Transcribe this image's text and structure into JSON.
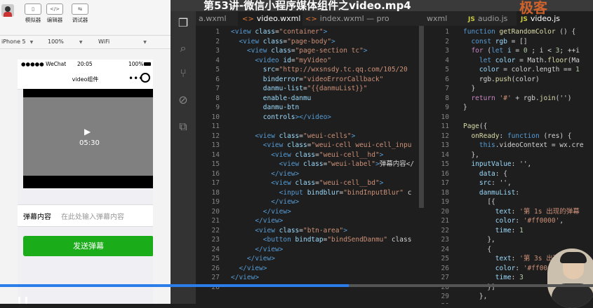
{
  "video_title": "第53讲-微信小程序媒体组件之video.mp4",
  "watermark": "极客",
  "simulator": {
    "toolbar": {
      "tools": [
        {
          "label": "模拟器",
          "icon": "phone-icon"
        },
        {
          "label": "编辑器",
          "icon": "code-icon"
        },
        {
          "label": "调试器",
          "icon": "debug-icon"
        }
      ]
    },
    "device": "iPhone 5",
    "zoom": "100%",
    "network": "WiFi",
    "status": {
      "carrier": "●●●●● WeChat",
      "time": "20:05",
      "battery": "100%"
    },
    "nav_title": "video组件",
    "video": {
      "duration": "05:30"
    },
    "danmu_label": "弹幕内容",
    "danmu_placeholder": "在此处输入弹幕内容",
    "send_button": "发送弹幕"
  },
  "tabs": {
    "left": [
      {
        "label": "a.wxml",
        "type": "wxml",
        "active": false
      },
      {
        "label": "video.wxml",
        "type": "wxml",
        "active": true
      },
      {
        "label": "index.wxml — pro",
        "type": "wxml",
        "active": false
      }
    ],
    "right": [
      {
        "label": "wxml",
        "type": "wxml",
        "active": false
      },
      {
        "label": "audio.js",
        "type": "js",
        "active": false
      },
      {
        "label": "video.js",
        "type": "js",
        "active": true
      }
    ]
  },
  "editor_left": {
    "line_numbers": [
      "1",
      "2",
      "3",
      "4",
      "5",
      "6",
      "7",
      "8",
      "9",
      "10",
      "11",
      "12",
      "13",
      "14",
      "15",
      "16",
      "17",
      "18",
      "19",
      "20",
      "21",
      "22",
      "23",
      "24",
      "25",
      "26",
      "27",
      "28"
    ],
    "lines": [
      [
        [
          "tg",
          "<view "
        ],
        [
          "at",
          "class"
        ],
        [
          "pl",
          "="
        ],
        [
          "sv",
          "\"container\""
        ],
        [
          "tg",
          ">"
        ]
      ],
      [
        [
          "pl",
          "  "
        ],
        [
          "tg",
          "<view "
        ],
        [
          "at",
          "class"
        ],
        [
          "pl",
          "="
        ],
        [
          "sv",
          "\"page-body\""
        ],
        [
          "tg",
          ">"
        ]
      ],
      [
        [
          "pl",
          "    "
        ],
        [
          "tg",
          "<view "
        ],
        [
          "at",
          "class"
        ],
        [
          "pl",
          "="
        ],
        [
          "sv",
          "\"page-section tc\""
        ],
        [
          "tg",
          ">"
        ]
      ],
      [
        [
          "pl",
          "      "
        ],
        [
          "tg",
          "<video "
        ],
        [
          "at",
          "id"
        ],
        [
          "pl",
          "="
        ],
        [
          "sv",
          "\"myVideo\""
        ]
      ],
      [
        [
          "pl",
          "        "
        ],
        [
          "at",
          "src"
        ],
        [
          "pl",
          "="
        ],
        [
          "sv",
          "\"http://wxsnsdy.tc.qq.com/105/20"
        ]
      ],
      [
        [
          "pl",
          "        "
        ],
        [
          "at",
          "binderror"
        ],
        [
          "pl",
          "="
        ],
        [
          "sv",
          "\"videoErrorCallback\""
        ]
      ],
      [
        [
          "pl",
          "        "
        ],
        [
          "at",
          "danmu-list"
        ],
        [
          "pl",
          "="
        ],
        [
          "sv",
          "\"{{danmuList}}\""
        ]
      ],
      [
        [
          "pl",
          "        "
        ],
        [
          "at",
          "enable-danmu"
        ]
      ],
      [
        [
          "pl",
          "        "
        ],
        [
          "at",
          "danmu-btn"
        ]
      ],
      [
        [
          "pl",
          "        "
        ],
        [
          "at",
          "controls"
        ],
        [
          "tg",
          "></video>"
        ]
      ],
      [
        [
          "pl",
          ""
        ]
      ],
      [
        [
          "pl",
          "      "
        ],
        [
          "tg",
          "<view "
        ],
        [
          "at",
          "class"
        ],
        [
          "pl",
          "="
        ],
        [
          "sv",
          "\"weui-cells\""
        ],
        [
          "tg",
          ">"
        ]
      ],
      [
        [
          "pl",
          "        "
        ],
        [
          "tg",
          "<view "
        ],
        [
          "at",
          "class"
        ],
        [
          "pl",
          "="
        ],
        [
          "sv",
          "\"weui-cell weui-cell_inpu"
        ]
      ],
      [
        [
          "pl",
          "          "
        ],
        [
          "tg",
          "<view "
        ],
        [
          "at",
          "class"
        ],
        [
          "pl",
          "="
        ],
        [
          "sv",
          "\"weui-cell__hd\""
        ],
        [
          "tg",
          ">"
        ]
      ],
      [
        [
          "pl",
          "            "
        ],
        [
          "tg",
          "<view "
        ],
        [
          "at",
          "class"
        ],
        [
          "pl",
          "="
        ],
        [
          "sv",
          "\"weui-label\""
        ],
        [
          "tg",
          ">"
        ],
        [
          "pl",
          "弹幕内容</"
        ]
      ],
      [
        [
          "pl",
          "          "
        ],
        [
          "tg",
          "</view>"
        ]
      ],
      [
        [
          "pl",
          "          "
        ],
        [
          "tg",
          "<view "
        ],
        [
          "at",
          "class"
        ],
        [
          "pl",
          "="
        ],
        [
          "sv",
          "\"weui-cell__bd\""
        ],
        [
          "tg",
          ">"
        ]
      ],
      [
        [
          "pl",
          "            "
        ],
        [
          "tg",
          "<input "
        ],
        [
          "at",
          "bindblur"
        ],
        [
          "pl",
          "="
        ],
        [
          "sv",
          "\"bindInputBlur\""
        ],
        [
          "pl",
          " c"
        ]
      ],
      [
        [
          "pl",
          "          "
        ],
        [
          "tg",
          "</view>"
        ]
      ],
      [
        [
          "pl",
          "        "
        ],
        [
          "tg",
          "</view>"
        ]
      ],
      [
        [
          "pl",
          "      "
        ],
        [
          "tg",
          "</view>"
        ]
      ],
      [
        [
          "pl",
          "      "
        ],
        [
          "tg",
          "<view "
        ],
        [
          "at",
          "class"
        ],
        [
          "pl",
          "="
        ],
        [
          "sv",
          "\"btn-area\""
        ],
        [
          "tg",
          ">"
        ]
      ],
      [
        [
          "pl",
          "        "
        ],
        [
          "tg",
          "<button "
        ],
        [
          "at",
          "bindtap"
        ],
        [
          "pl",
          "="
        ],
        [
          "sv",
          "\"bindSendDanmu\""
        ],
        [
          "pl",
          " class"
        ]
      ],
      [
        [
          "pl",
          "      "
        ],
        [
          "tg",
          "</view>"
        ]
      ],
      [
        [
          "pl",
          "    "
        ],
        [
          "tg",
          "</view>"
        ]
      ],
      [
        [
          "pl",
          "  "
        ],
        [
          "tg",
          "</view>"
        ]
      ],
      [
        [
          "tg",
          "</view>"
        ]
      ],
      [
        [
          "pl",
          ""
        ]
      ]
    ]
  },
  "editor_right": {
    "line_numbers": [
      "1",
      "2",
      "3",
      "4",
      "5",
      "6",
      "7",
      "8",
      "9",
      "10",
      "11",
      "12",
      "13",
      "14",
      "15",
      "16",
      "17",
      "18",
      "19",
      "20",
      "21",
      "22",
      "23",
      "24",
      "25",
      "26",
      "27",
      "28",
      "29",
      "30"
    ],
    "lines": [
      [
        [
          "kw2",
          "function "
        ],
        [
          "fn",
          "getRandomColor"
        ],
        [
          "pl",
          " () {"
        ]
      ],
      [
        [
          "pl",
          "  "
        ],
        [
          "kw2",
          "const "
        ],
        [
          "at",
          "rgb"
        ],
        [
          "pl",
          " = []"
        ]
      ],
      [
        [
          "pl",
          "  "
        ],
        [
          "kw",
          "for"
        ],
        [
          "pl",
          " ("
        ],
        [
          "kw2",
          "let "
        ],
        [
          "at",
          "i"
        ],
        [
          "pl",
          " = "
        ],
        [
          "nm",
          "0"
        ],
        [
          "pl",
          " ; i < "
        ],
        [
          "nm",
          "3"
        ],
        [
          "pl",
          "; ++i"
        ]
      ],
      [
        [
          "pl",
          "    "
        ],
        [
          "kw2",
          "let "
        ],
        [
          "at",
          "color"
        ],
        [
          "pl",
          " = Math."
        ],
        [
          "fn",
          "floor"
        ],
        [
          "pl",
          "(Ma"
        ]
      ],
      [
        [
          "pl",
          "    "
        ],
        [
          "at",
          "color"
        ],
        [
          "pl",
          " = color.length == "
        ],
        [
          "nm",
          "1"
        ]
      ],
      [
        [
          "pl",
          "    rgb."
        ],
        [
          "fn",
          "push"
        ],
        [
          "pl",
          "(color)"
        ]
      ],
      [
        [
          "pl",
          "  }"
        ]
      ],
      [
        [
          "pl",
          "  "
        ],
        [
          "kw",
          "return "
        ],
        [
          "sv",
          "'#'"
        ],
        [
          "pl",
          " + rgb."
        ],
        [
          "fn",
          "join"
        ],
        [
          "pl",
          "('')"
        ]
      ],
      [
        [
          "pl",
          "}"
        ]
      ],
      [
        [
          "pl",
          ""
        ]
      ],
      [
        [
          "fn",
          "Page"
        ],
        [
          "pl",
          "({"
        ]
      ],
      [
        [
          "pl",
          "  "
        ],
        [
          "fn",
          "onReady"
        ],
        [
          "pl",
          ": "
        ],
        [
          "kw2",
          "function"
        ],
        [
          "pl",
          " (res) {"
        ]
      ],
      [
        [
          "pl",
          "    "
        ],
        [
          "kw2",
          "this"
        ],
        [
          "pl",
          ".videoContext = wx.cre"
        ]
      ],
      [
        [
          "pl",
          "  },"
        ]
      ],
      [
        [
          "pl",
          "  "
        ],
        [
          "at",
          "inputValue"
        ],
        [
          "pl",
          ": '',"
        ]
      ],
      [
        [
          "pl",
          "    "
        ],
        [
          "at",
          "data"
        ],
        [
          "pl",
          ": {"
        ]
      ],
      [
        [
          "pl",
          "    "
        ],
        [
          "at",
          "src"
        ],
        [
          "pl",
          ": '',"
        ]
      ],
      [
        [
          "pl",
          "    "
        ],
        [
          "at",
          "danmuList"
        ],
        [
          "pl",
          ":"
        ]
      ],
      [
        [
          "pl",
          "      [{"
        ]
      ],
      [
        [
          "pl",
          "        "
        ],
        [
          "at",
          "text"
        ],
        [
          "pl",
          ": "
        ],
        [
          "sv",
          "'第 1s 出现的弹幕"
        ]
      ],
      [
        [
          "pl",
          "        "
        ],
        [
          "at",
          "color"
        ],
        [
          "pl",
          ": "
        ],
        [
          "sv",
          "'#ff0000'"
        ],
        [
          "pl",
          ","
        ]
      ],
      [
        [
          "pl",
          "        "
        ],
        [
          "at",
          "time"
        ],
        [
          "pl",
          ": "
        ],
        [
          "nm",
          "1"
        ]
      ],
      [
        [
          "pl",
          "      },"
        ]
      ],
      [
        [
          "pl",
          "      {"
        ]
      ],
      [
        [
          "pl",
          "        "
        ],
        [
          "at",
          "text"
        ],
        [
          "pl",
          ": "
        ],
        [
          "sv",
          "'第 3s 出现的弹幕"
        ]
      ],
      [
        [
          "pl",
          "        "
        ],
        [
          "at",
          "color"
        ],
        [
          "pl",
          ": "
        ],
        [
          "sv",
          "'#ff00ff'"
        ]
      ],
      [
        [
          "pl",
          "        "
        ],
        [
          "at",
          "time"
        ],
        [
          "pl",
          ": "
        ],
        [
          "nm",
          "3"
        ]
      ],
      [
        [
          "pl",
          "      }]"
        ]
      ],
      [
        [
          "pl",
          "    },"
        ]
      ],
      [
        [
          "pl",
          ""
        ]
      ]
    ]
  },
  "player": {
    "progress_fraction": 0.588
  }
}
